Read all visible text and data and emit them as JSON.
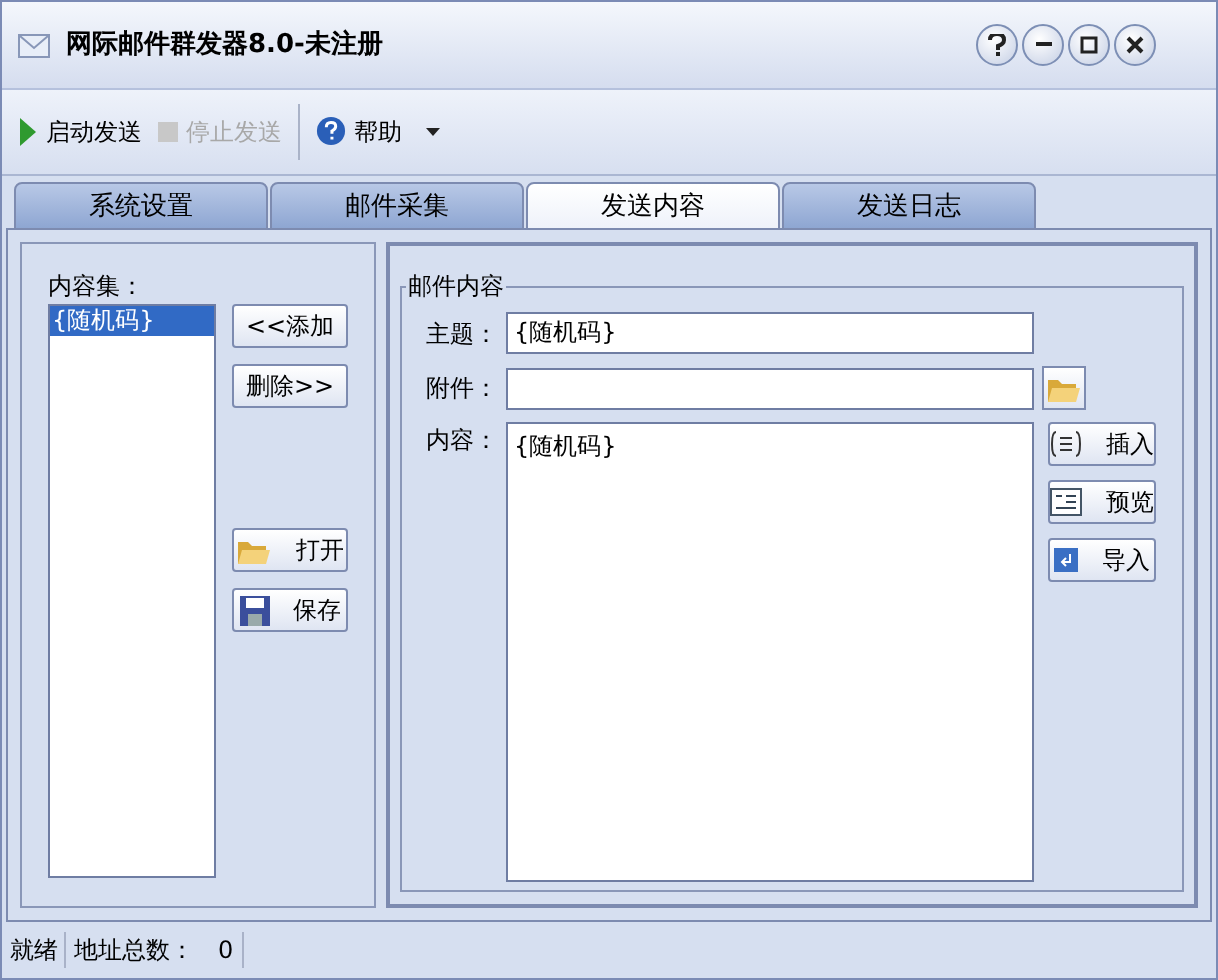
{
  "window": {
    "title": "网际邮件群发器8.0-未注册"
  },
  "toolbar": [
    {
      "label": "启动发送",
      "kind": "play",
      "disabled": false
    },
    {
      "label": "停止发送",
      "kind": "stop",
      "disabled": true
    },
    {
      "label": "帮助",
      "kind": "help",
      "disabled": false
    }
  ],
  "tabs": [
    {
      "label": "系统设置",
      "selected": false
    },
    {
      "label": "邮件采集",
      "selected": false
    },
    {
      "label": "发送内容",
      "selected": true
    },
    {
      "label": "发送日志",
      "selected": false
    }
  ],
  "content_set": {
    "label": "内容集：",
    "items": [
      {
        "label": "{随机码}",
        "selected": true
      }
    ]
  },
  "left_buttons": [
    {
      "label": "<<添加",
      "kind": "plain"
    },
    {
      "label": "删除>>",
      "kind": "plain"
    },
    {
      "label": "打开",
      "kind": "open"
    },
    {
      "label": "保存",
      "kind": "save"
    }
  ],
  "mail": {
    "title": "邮件内容",
    "subject": {
      "label": "主题：",
      "value": "{随机码}"
    },
    "attachment": {
      "label": "附件："
    },
    "body": {
      "label": "内容：",
      "value": "{随机码}"
    }
  },
  "right_buttons": [
    {
      "label": "插入",
      "kind": "insert"
    },
    {
      "label": "预览",
      "kind": "preview"
    },
    {
      "label": "导入",
      "kind": "import"
    }
  ],
  "status_bar": {
    "status": "就绪",
    "count_label": "地址总数：",
    "count": "0"
  }
}
